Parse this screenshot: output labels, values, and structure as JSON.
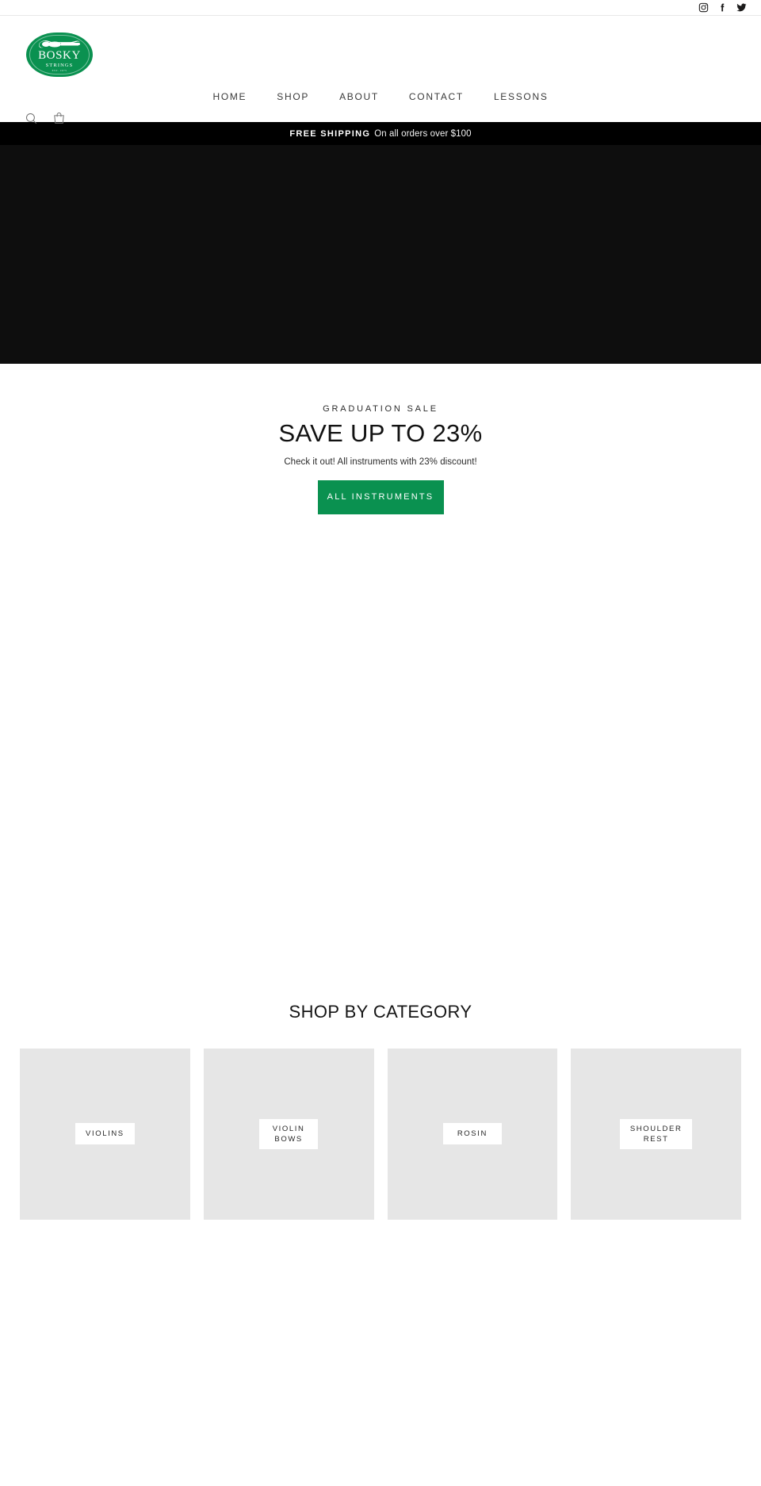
{
  "topbar": {
    "socials": [
      {
        "name": "instagram-icon",
        "label": "Instagram"
      },
      {
        "name": "facebook-icon",
        "label": "Facebook"
      },
      {
        "name": "twitter-icon",
        "label": "Twitter"
      }
    ]
  },
  "brand": {
    "name": "BOSKY",
    "sub": "STRINGS",
    "est": "EST. 1975",
    "logo_color": "#0a9150"
  },
  "nav": {
    "items": [
      {
        "label": "HOME"
      },
      {
        "label": "SHOP"
      },
      {
        "label": "ABOUT"
      },
      {
        "label": "CONTACT"
      },
      {
        "label": "LESSONS"
      }
    ]
  },
  "header_icons": [
    {
      "name": "search-icon",
      "label": "Search"
    },
    {
      "name": "cart-icon",
      "label": "Cart"
    }
  ],
  "announcement": {
    "strong": "FREE SHIPPING",
    "text": "On all orders over $100"
  },
  "hero": {
    "eyebrow": "GRADUATION SALE",
    "title": "SAVE UP TO 23%",
    "subtitle": "Check it out! All instruments with 23% discount!",
    "cta_label": "ALL INSTRUMENTS",
    "cta_color": "#0a9150",
    "media_color": "#0e0e0e"
  },
  "categories": {
    "heading": "SHOP BY CATEGORY",
    "cards": [
      {
        "label": "VIOLINS"
      },
      {
        "label": "VIOLIN BOWS"
      },
      {
        "label": "ROSIN"
      },
      {
        "label": "SHOULDER REST"
      }
    ]
  }
}
